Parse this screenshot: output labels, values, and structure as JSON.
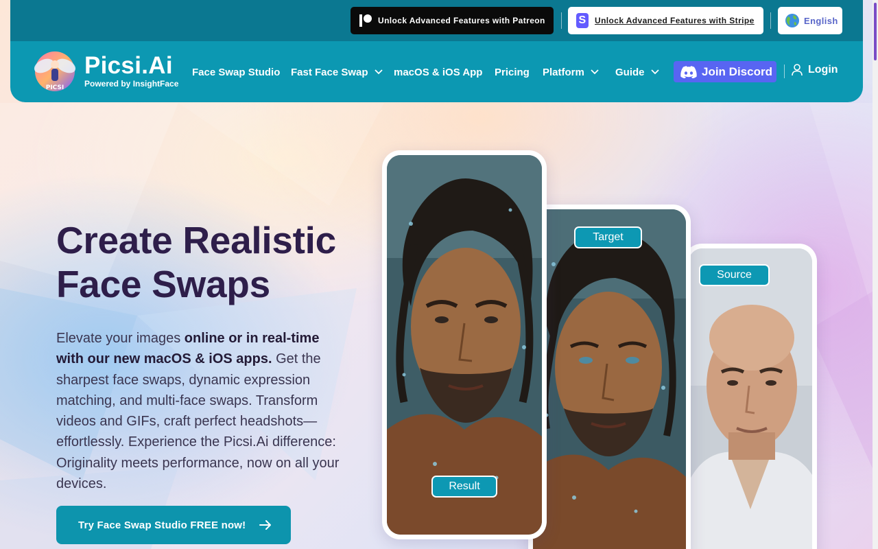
{
  "topbar": {
    "patreon_label": "Unlock Advanced Features with Patreon",
    "stripe_label": "Unlock Advanced Features with Stripe",
    "language_label": "English",
    "colors": {
      "bar": "#0b7891",
      "stripe": "#635bff",
      "patreon": "#0a0a0a"
    }
  },
  "brand": {
    "name": "Picsi.Ai",
    "tagline": "Powered by InsightFace",
    "logo_text": "PICSI"
  },
  "nav": {
    "items": [
      {
        "label": "Face Swap Studio",
        "has_dropdown": false
      },
      {
        "label": "Fast Face Swap",
        "has_dropdown": true
      },
      {
        "label": "macOS & iOS App",
        "has_dropdown": false
      },
      {
        "label": "Pricing",
        "has_dropdown": false
      },
      {
        "label": "Platform",
        "has_dropdown": true
      },
      {
        "label": "Guide",
        "has_dropdown": true
      }
    ],
    "discord_label": "Join Discord",
    "login_label": "Login",
    "colors": {
      "bar": "#0c98b2",
      "discord": "#5865f2"
    }
  },
  "hero": {
    "title_line1": "Create Realistic",
    "title_line2": "Face Swaps",
    "copy_intro": "Elevate your images ",
    "copy_bold": "online or in real-time with our new macOS & iOS apps.",
    "copy_rest": " Get the sharpest face swaps, dynamic expression matching, and multi-face swaps. Transform videos and GIFs, craft perfect headshots—effortlessly. Experience the Picsi.Ai difference: Originality meets performance, now on all your devices.",
    "cta_label": "Try Face Swap Studio FREE now!",
    "colors": {
      "title": "#2e1e4a",
      "cta": "#0d94ad"
    }
  },
  "showcase": {
    "result_label": "Result",
    "target_label": "Target",
    "source_label": "Source"
  }
}
